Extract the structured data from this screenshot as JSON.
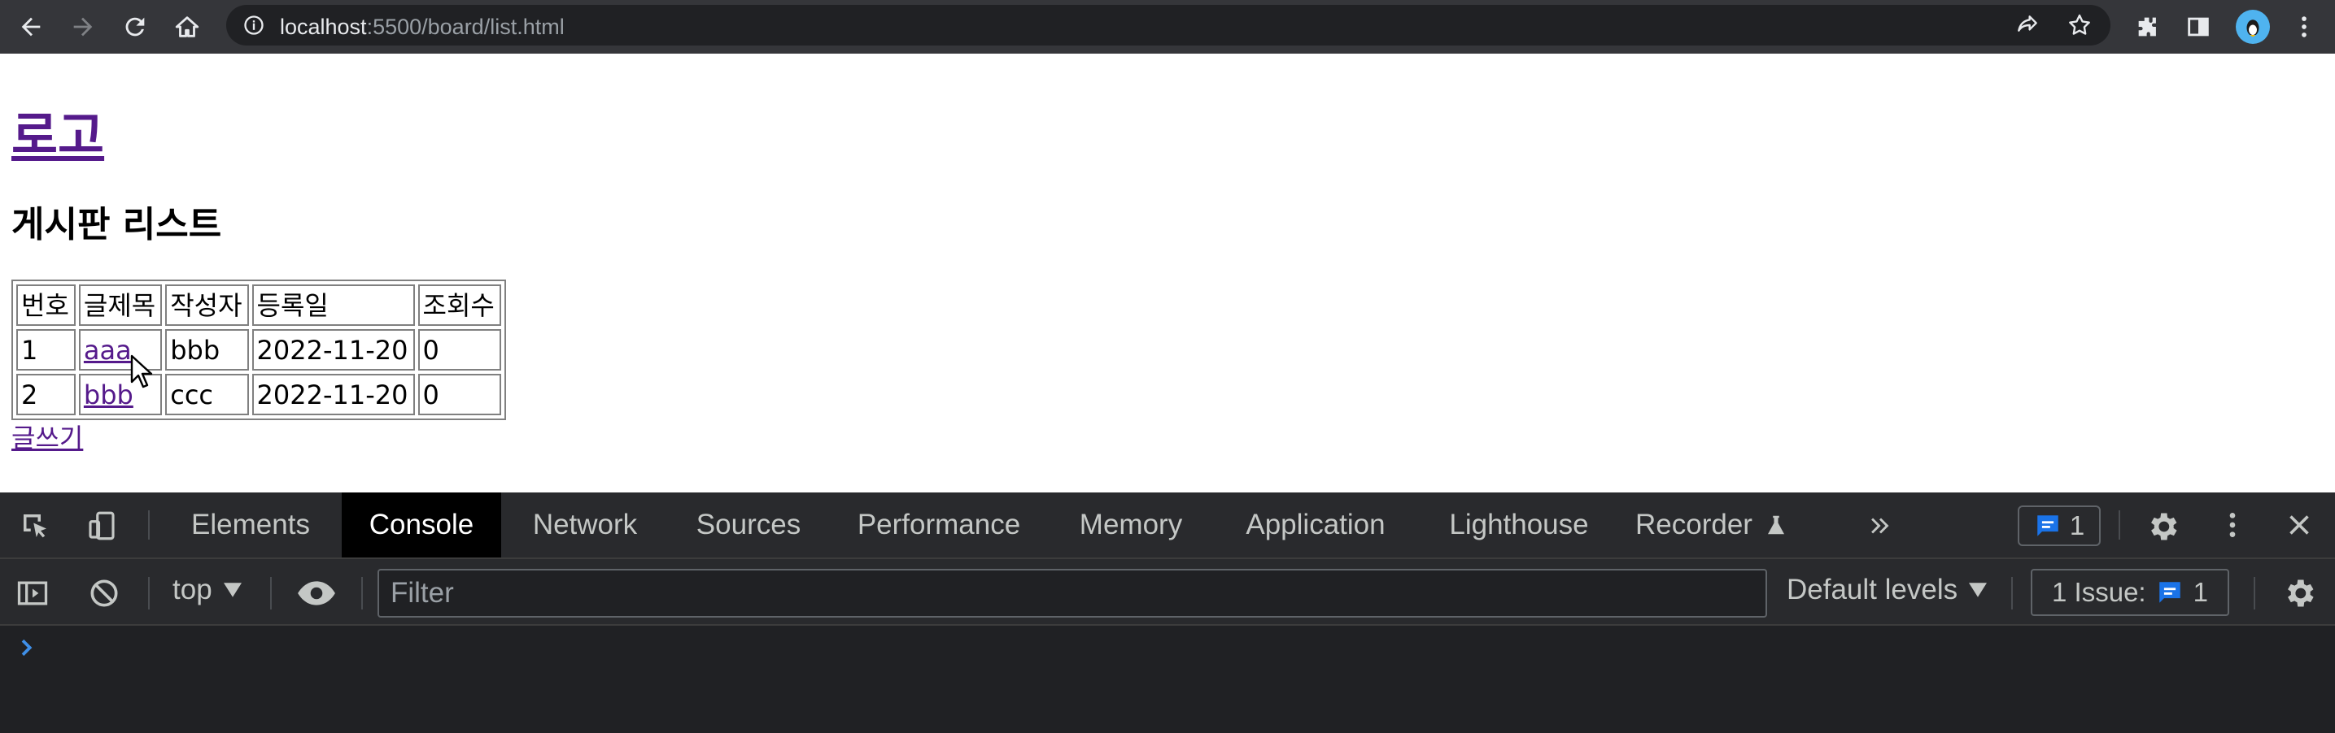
{
  "browser": {
    "url_host": "localhost",
    "url_path": ":5500/board/list.html"
  },
  "page": {
    "logo": "로고",
    "title": "게시판 리스트",
    "table": {
      "headers": [
        "번호",
        "글제목",
        "작성자",
        "등록일",
        "조회수"
      ],
      "rows": [
        {
          "no": "1",
          "title": "aaa",
          "author": "bbb",
          "date": "2022-11-20",
          "views": "0"
        },
        {
          "no": "2",
          "title": "bbb",
          "author": "ccc",
          "date": "2022-11-20",
          "views": "0"
        }
      ]
    },
    "write_link": "글쓰기"
  },
  "devtools": {
    "tabs": [
      "Elements",
      "Console",
      "Network",
      "Sources",
      "Performance",
      "Memory",
      "Application",
      "Lighthouse",
      "Recorder"
    ],
    "active_tab": "Console",
    "issues_count": "1",
    "console": {
      "context": "top",
      "filter_placeholder": "Filter",
      "levels": "Default levels",
      "issues_label": "1 Issue:",
      "issues_count": "1"
    }
  },
  "colors": {
    "visited_link": "#551a8b",
    "devtools_bg": "#202124",
    "accent_blue": "#1a73e8"
  }
}
